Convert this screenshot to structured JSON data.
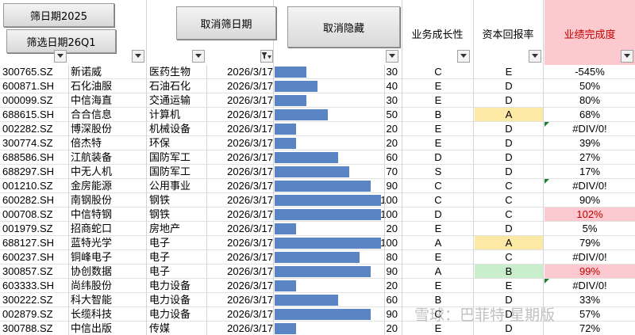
{
  "toolbar": {
    "filter_date_2025": "筛日期2025",
    "filter_date_26q1": "筛选日期26Q1",
    "cancel_filter_date": "取消筛日期",
    "cancel_hide": "取消隐藏"
  },
  "headers": {
    "growth": "业务成长性",
    "roe": "资本回报率",
    "performance": "业绩完成度"
  },
  "colors": {
    "bar": "#5b84c4",
    "highlight_yellow": "#fde9a6",
    "highlight_green": "#c8eecb",
    "highlight_pink": "#fbc9cf",
    "red_text": "#c00000"
  },
  "rows": [
    {
      "code": "300765.SZ",
      "name": "新诺威",
      "industry": "医药生物",
      "date": "2026/3/17",
      "score": "30",
      "bar_pct": 30,
      "growth": "C",
      "roe": "E",
      "perf": "-545%",
      "roe_hl": "",
      "perf_hl": "",
      "flag": false
    },
    {
      "code": "600871.SH",
      "name": "石化油服",
      "industry": "石油石化",
      "date": "2026/3/17",
      "score": "40",
      "bar_pct": 40,
      "growth": "E",
      "roe": "D",
      "perf": "50%",
      "roe_hl": "",
      "perf_hl": "",
      "flag": false
    },
    {
      "code": "000099.SZ",
      "name": "中信海直",
      "industry": "交通运输",
      "date": "2026/3/17",
      "score": "30",
      "bar_pct": 30,
      "growth": "E",
      "roe": "D",
      "perf": "80%",
      "roe_hl": "",
      "perf_hl": "",
      "flag": false
    },
    {
      "code": "688615.SH",
      "name": "合合信息",
      "industry": "计算机",
      "date": "2026/3/17",
      "score": "50",
      "bar_pct": 50,
      "growth": "B",
      "roe": "A",
      "perf": "68%",
      "roe_hl": "yellow",
      "perf_hl": "",
      "flag": false
    },
    {
      "code": "002282.SZ",
      "name": "博深股份",
      "industry": "机械设备",
      "date": "2026/3/17",
      "score": "20",
      "bar_pct": 20,
      "growth": "E",
      "roe": "D",
      "perf": "#DIV/0!",
      "roe_hl": "",
      "perf_hl": "",
      "flag": true
    },
    {
      "code": "300774.SZ",
      "name": "倍杰特",
      "industry": "环保",
      "date": "2026/3/17",
      "score": "20",
      "bar_pct": 20,
      "growth": "E",
      "roe": "D",
      "perf": "39%",
      "roe_hl": "",
      "perf_hl": "",
      "flag": false
    },
    {
      "code": "688586.SH",
      "name": "江航装备",
      "industry": "国防军工",
      "date": "2026/3/17",
      "score": "60",
      "bar_pct": 60,
      "growth": "D",
      "roe": "D",
      "perf": "27%",
      "roe_hl": "",
      "perf_hl": "",
      "flag": false
    },
    {
      "code": "688297.SH",
      "name": "中无人机",
      "industry": "国防军工",
      "date": "2026/3/17",
      "score": "70",
      "bar_pct": 70,
      "growth": "S",
      "roe": "D",
      "perf": "17%",
      "roe_hl": "",
      "perf_hl": "",
      "flag": false
    },
    {
      "code": "001210.SZ",
      "name": "金房能源",
      "industry": "公用事业",
      "date": "2026/3/17",
      "score": "90",
      "bar_pct": 90,
      "growth": "C",
      "roe": "C",
      "perf": "#DIV/0!",
      "roe_hl": "",
      "perf_hl": "",
      "flag": true
    },
    {
      "code": "600282.SH",
      "name": "南钢股份",
      "industry": "钢铁",
      "date": "2026/3/17",
      "score": "100",
      "bar_pct": 100,
      "growth": "C",
      "roe": "C",
      "perf": "90%",
      "roe_hl": "",
      "perf_hl": "",
      "flag": false
    },
    {
      "code": "000708.SZ",
      "name": "中信特钢",
      "industry": "钢铁",
      "date": "2026/3/17",
      "score": "100",
      "bar_pct": 100,
      "growth": "D",
      "roe": "C",
      "perf": "102%",
      "roe_hl": "",
      "perf_hl": "pink",
      "flag": false
    },
    {
      "code": "001979.SZ",
      "name": "招商蛇口",
      "industry": "房地产",
      "date": "2026/3/17",
      "score": "20",
      "bar_pct": 20,
      "growth": "E",
      "roe": "D",
      "perf": "5%",
      "roe_hl": "",
      "perf_hl": "",
      "flag": false
    },
    {
      "code": "688127.SH",
      "name": "蓝特光学",
      "industry": "电子",
      "date": "2026/3/17",
      "score": "100",
      "bar_pct": 100,
      "growth": "A",
      "roe": "A",
      "perf": "79%",
      "roe_hl": "yellow",
      "perf_hl": "",
      "flag": false
    },
    {
      "code": "600237.SH",
      "name": "铜峰电子",
      "industry": "电子",
      "date": "2026/3/17",
      "score": "80",
      "bar_pct": 80,
      "growth": "E",
      "roe": "C",
      "perf": "#DIV/0!",
      "roe_hl": "",
      "perf_hl": "",
      "flag": false
    },
    {
      "code": "300857.SZ",
      "name": "协创数据",
      "industry": "电子",
      "date": "2026/3/17",
      "score": "90",
      "bar_pct": 90,
      "growth": "A",
      "roe": "B",
      "perf": "99%",
      "roe_hl": "green",
      "perf_hl": "pink",
      "flag": false
    },
    {
      "code": "603333.SH",
      "name": "尚纬股份",
      "industry": "电力设备",
      "date": "2026/3/17",
      "score": "20",
      "bar_pct": 20,
      "growth": "E",
      "roe": "E",
      "perf": "#DIV/0!",
      "roe_hl": "",
      "perf_hl": "",
      "flag": true
    },
    {
      "code": "300222.SZ",
      "name": "科大智能",
      "industry": "电力设备",
      "date": "2026/3/17",
      "score": "60",
      "bar_pct": 60,
      "growth": "B",
      "roe": "D",
      "perf": "33%",
      "roe_hl": "",
      "perf_hl": "",
      "flag": false
    },
    {
      "code": "002879.SZ",
      "name": "长缆科技",
      "industry": "电力设备",
      "date": "2026/3/17",
      "score": "90",
      "bar_pct": 90,
      "growth": "C",
      "roe": "D",
      "perf": "57%",
      "roe_hl": "",
      "perf_hl": "",
      "flag": false
    },
    {
      "code": "300788.SZ",
      "name": "中信出版",
      "industry": "传媒",
      "date": "2026/3/17",
      "score": "20",
      "bar_pct": 20,
      "growth": "E",
      "roe": "D",
      "perf": "72%",
      "roe_hl": "",
      "perf_hl": "",
      "flag": false
    }
  ],
  "watermark": "雪球：巴菲特·星期版"
}
